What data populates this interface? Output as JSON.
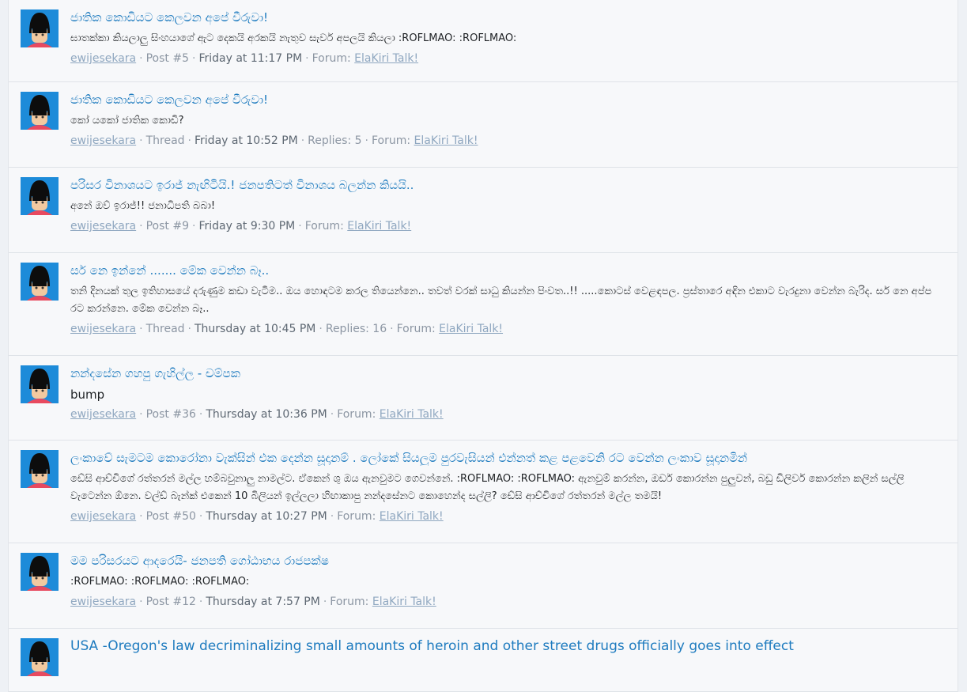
{
  "results": [
    {
      "title": "ජාතික කොඩියට කෙලවන අපේ වීරුවා!",
      "snippet": "ඝාතක්කා කියලාලු සිංහයාගේ ඇට දෙකයි අරකයි නැතුව සැර්ව අපලයි කියලා :ROFLMAO: :ROFLMAO:",
      "user": "ewijesekara",
      "type": "Post #5",
      "time": "Friday at 11:17 PM",
      "replies": "",
      "forum_prefix": "Forum:",
      "forum": "ElaKiri Talk!"
    },
    {
      "title": "ජාතික කොඩියට කෙලවන අපේ වීරුවා!",
      "snippet": "කෝ යකෝ ජාතික කොඩි?",
      "user": "ewijesekara",
      "type": "Thread",
      "time": "Friday at 10:52 PM",
      "replies": "Replies: 5",
      "forum_prefix": "Forum:",
      "forum": "ElaKiri Talk!"
    },
    {
      "title": "පරිසර විනාශයට ඉරාජ් නැඟිටියි.! ජනපතිටත් විනාශය බලන්න කියයි..",
      "snippet": "අනේ ඔව් ඉරාජ්!! ජනාධිපති බබා!",
      "user": "ewijesekara",
      "type": "Post #9",
      "time": "Friday at 9:30 PM",
      "replies": "",
      "forum_prefix": "Forum:",
      "forum": "ElaKiri Talk!"
    },
    {
      "title": "සර් නෙ ඉන්නේ ....... මේක වෙන්න බෑ..",
      "snippet": "තනි දිනයක් තුල ඉතිහාසයේ දරුණුම කඩා වැටීම.. ඔය හොඳටම කරල තියෙන්නෙ.. තවත් වරක් සාධු කියන්න පිංවත..!! .....කොටස් වෙළඳපල. ප්‍රස්තාරෙ අඳින එකාට වැරදුනා වෙන්න බැරිද. සර් නෙ අප්ප රට කරන්නෙ. මේක වෙන්න බෑ..",
      "user": "ewijesekara",
      "type": "Thread",
      "time": "Thursday at 10:45 PM",
      "replies": "Replies: 16",
      "forum_prefix": "Forum:",
      "forum": "ElaKiri Talk!"
    },
    {
      "title": "නන්දසේන ගහපු ගැහිල්ල - චම්පක",
      "snippet": "bump",
      "user": "ewijesekara",
      "type": "Post #36",
      "time": "Thursday at 10:36 PM",
      "replies": "",
      "forum_prefix": "Forum:",
      "forum": "ElaKiri Talk!"
    },
    {
      "title": "ලංකාවේ සැමටම කොරෝනා වැක්සින් එක දෙන්න සූදානම් . ලෝකේ සියලුම පුරවැසියන් එන්නත් කළ පළවෙනි රට වෙන්න ලංකාව සූදානමින්",
      "snippet": "ඩේසි ආච්චිගේ රත්තරන් මල්ල හම්බවුනාලු නාමල්ට. ඒකෙන් ශු ඔය ඇනවුමට ගෙවන්නේ. :ROFLMAO: :ROFLMAO: ඇනවුම් කරන්න, ඔඩර් කොරන්න පුලුවන්, බඩු ඩිලිවර් කොරන්න කලින් සල්ලි වැටෙන්න ඕනෙ. වල්ඩ් බැන්ක් එකෙන් 10 බිලියන් ඉල්ලලා හිඟාකාපු නන්දසේනට කොහෙන්ද සල්ලි? ඩේසි ආච්චිගේ රත්තරන් මල්ල තමයි!",
      "user": "ewijesekara",
      "type": "Post #50",
      "time": "Thursday at 10:27 PM",
      "replies": "",
      "forum_prefix": "Forum:",
      "forum": "ElaKiri Talk!"
    },
    {
      "title": "මම පරිසරයට ආදරෙයි- ජනපති ගෝඨාභය රාජපක්ෂ",
      "snippet": ":ROFLMAO: :ROFLMAO: :ROFLMAO:",
      "user": "ewijesekara",
      "type": "Post #12",
      "time": "Thursday at 7:57 PM",
      "replies": "",
      "forum_prefix": "Forum:",
      "forum": "ElaKiri Talk!"
    },
    {
      "title": "USA -Oregon's law decriminalizing small amounts of heroin and other street drugs officially goes into effect",
      "snippet": "",
      "user": "",
      "type": "",
      "time": "",
      "replies": "",
      "forum_prefix": "",
      "forum": ""
    }
  ]
}
